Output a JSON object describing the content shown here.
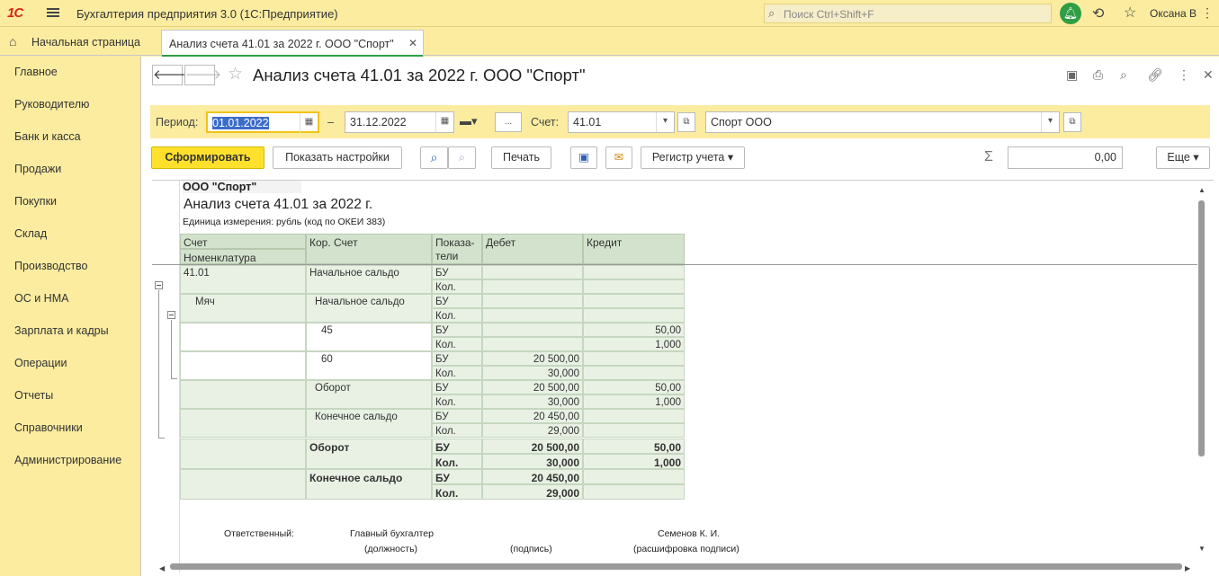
{
  "app": {
    "logo": "1С",
    "title": "Бухгалтерия предприятия 3.0  (1С:Предприятие)",
    "search_placeholder": "Поиск Ctrl+Shift+F",
    "user": "Оксана В"
  },
  "tabs": {
    "home_label": "Начальная страница",
    "active_label": "Анализ счета 41.01 за 2022 г. ООО \"Спорт\""
  },
  "sidebar": {
    "items": [
      {
        "label": "Главное"
      },
      {
        "label": "Руководителю"
      },
      {
        "label": "Банк и касса"
      },
      {
        "label": "Продажи"
      },
      {
        "label": "Покупки"
      },
      {
        "label": "Склад"
      },
      {
        "label": "Производство"
      },
      {
        "label": "ОС и НМА"
      },
      {
        "label": "Зарплата и кадры"
      },
      {
        "label": "Операции"
      },
      {
        "label": "Отчеты"
      },
      {
        "label": "Справочники"
      },
      {
        "label": "Администрирование"
      }
    ]
  },
  "doc": {
    "title": "Анализ счета 41.01 за 2022 г. ООО \"Спорт\""
  },
  "params": {
    "period_label": "Период:",
    "date_from": "01.01.2022",
    "dash": "–",
    "date_to": "31.12.2022",
    "ellipsis": "...",
    "account_label": "Счет:",
    "account_value": "41.01",
    "org_value": "Спорт ООО"
  },
  "commands": {
    "generate": "Сформировать",
    "show_settings": "Показать настройки",
    "print": "Печать",
    "register": "Регистр учета",
    "more": "Еще",
    "sum_value": "0,00"
  },
  "report": {
    "org": "ООО \"Спорт\"",
    "title": "Анализ счета 41.01 за 2022 г.",
    "unit": "Единица измерения: рубль (код по ОКЕИ 383)",
    "headers": {
      "account": "Счет",
      "nomenclature": "Номенклатура",
      "corr_account": "Кор. Счет",
      "indicators": "Показа-\nтели",
      "debit": "Дебет",
      "credit": "Кредит"
    },
    "rows": [
      {
        "account": "41.01",
        "corr": "Начальное сальдо",
        "ind1": "БУ",
        "ind2": "Кол.",
        "d1": "",
        "d2": "",
        "c1": "",
        "c2": "",
        "bold": false
      },
      {
        "account": "Мяч",
        "corr": "Начальное сальдо",
        "ind1": "БУ",
        "ind2": "Кол.",
        "d1": "",
        "d2": "",
        "c1": "",
        "c2": "",
        "bold": false
      },
      {
        "account": "",
        "corr": "45",
        "ind1": "БУ",
        "ind2": "Кол.",
        "d1": "",
        "d2": "",
        "c1": "50,00",
        "c2": "1,000",
        "bold": false
      },
      {
        "account": "",
        "corr": "60",
        "ind1": "БУ",
        "ind2": "Кол.",
        "d1": "20 500,00",
        "d2": "30,000",
        "c1": "",
        "c2": "",
        "bold": false
      },
      {
        "account": "",
        "corr": "Оборот",
        "ind1": "БУ",
        "ind2": "Кол.",
        "d1": "20 500,00",
        "d2": "30,000",
        "c1": "50,00",
        "c2": "1,000",
        "bold": false
      },
      {
        "account": "",
        "corr": "Конечное сальдо",
        "ind1": "БУ",
        "ind2": "Кол.",
        "d1": "20 450,00",
        "d2": "29,000",
        "c1": "",
        "c2": "",
        "bold": false
      },
      {
        "account": "",
        "corr": "Оборот",
        "ind1": "БУ",
        "ind2": "Кол.",
        "d1": "20 500,00",
        "d2": "30,000",
        "c1": "50,00",
        "c2": "1,000",
        "bold": true
      },
      {
        "account": "",
        "corr": "Конечное сальдо",
        "ind1": "БУ",
        "ind2": "Кол.",
        "d1": "20 450,00",
        "d2": "29,000",
        "c1": "",
        "c2": "",
        "bold": true
      }
    ],
    "footer": {
      "responsible": "Ответственный:",
      "position_value": "Главный бухгалтер",
      "position_caption": "(должность)",
      "signature_caption": "(подпись)",
      "name_value": "Семенов К. И.",
      "name_caption": "(расшифровка подписи)"
    }
  }
}
